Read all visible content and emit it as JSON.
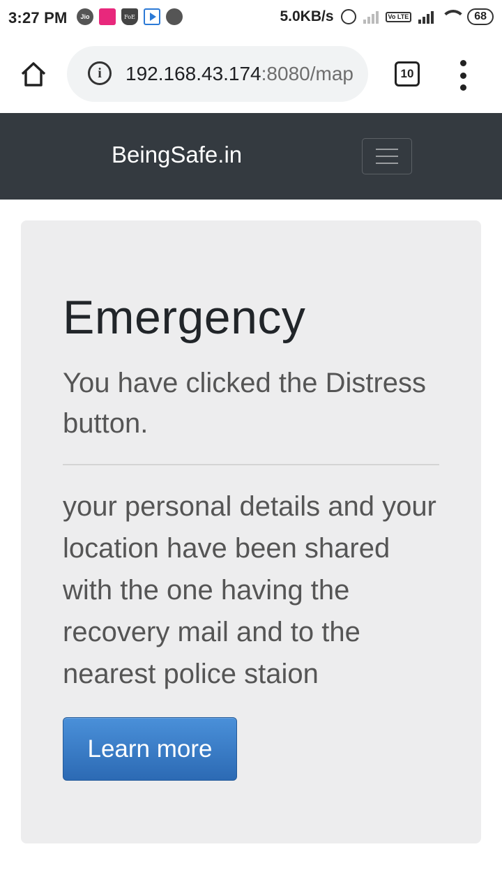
{
  "status_bar": {
    "time": "3:27 PM",
    "net_speed": "5.0KB/s",
    "battery": "68",
    "volte": "Vo LTE",
    "network": "4G",
    "icons": [
      "jio-icon",
      "fore-app-icon",
      "foe-app-icon",
      "video-app-icon",
      "phone-icon",
      "alarm-icon",
      "signal-icon",
      "wifi-icon",
      "battery-icon"
    ]
  },
  "browser": {
    "url_host": "192.168.43.174",
    "url_rest": ":8080/map",
    "tab_count": "10"
  },
  "navbar": {
    "brand": "BeingSafe.in"
  },
  "jumbotron": {
    "title": "Emergency",
    "lead": "You have clicked the Distress button.",
    "body": "your personal details and your location have been shared with the one having the recovery mail and to the nearest police staion",
    "button_label": "Learn more",
    "button_color": "#337ab7"
  }
}
